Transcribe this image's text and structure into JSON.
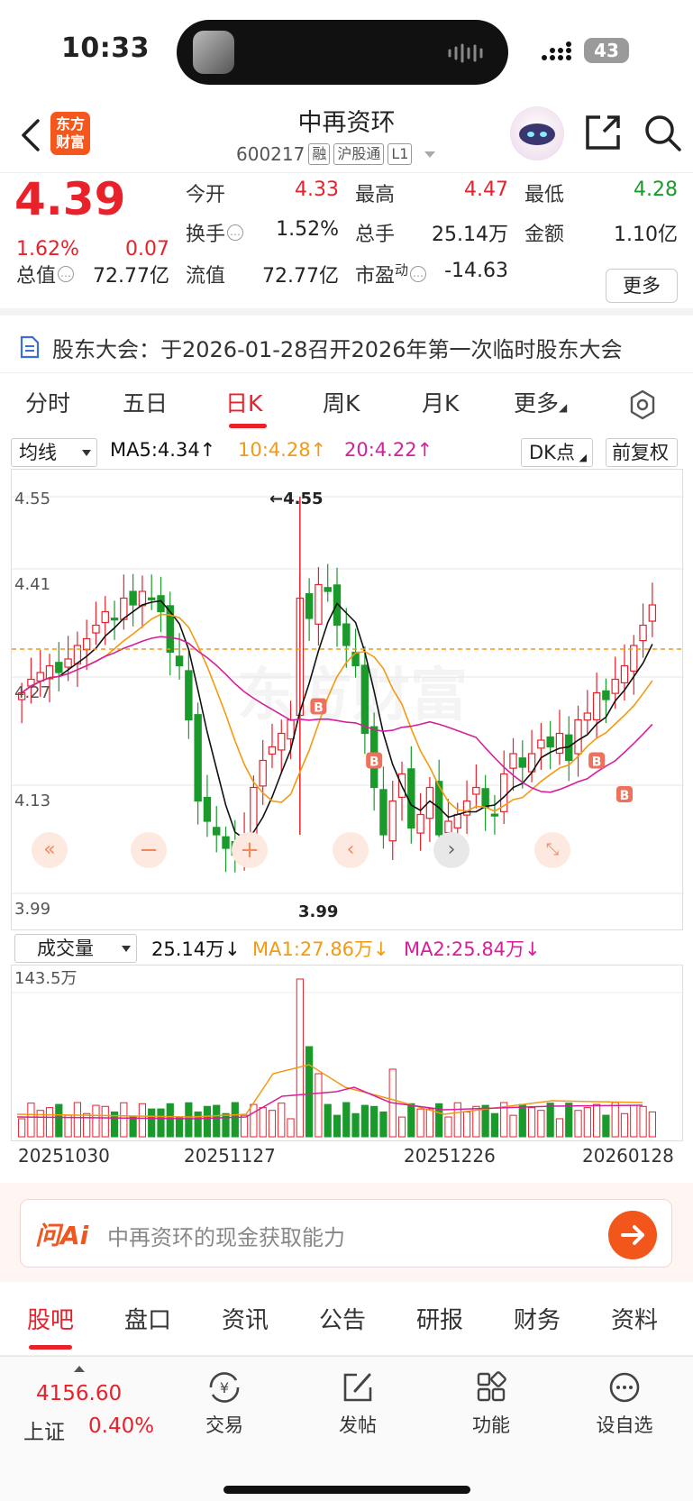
{
  "status": {
    "time": "10:33",
    "battery": "43"
  },
  "header": {
    "logo": "东方\n财富",
    "name": "中再资环",
    "code": "600217",
    "tags": [
      "融",
      "沪股通",
      "L1"
    ]
  },
  "quote": {
    "price": "4.39",
    "pct": "1.62%",
    "chg": "0.07",
    "rows": [
      {
        "l1": "今开",
        "v1": "4.33",
        "l2": "最高",
        "v2": "4.47",
        "l3": "最低",
        "v3": "4.28"
      },
      {
        "l1": "换手",
        "v1": "1.52%",
        "l2": "总手",
        "v2": "25.14万",
        "l3": "金额",
        "v3": "1.10亿"
      },
      {
        "l1": "总值",
        "v1": "72.77亿",
        "l2": "流值",
        "v2": "72.77亿",
        "l3": "市盈",
        "l3sup": "动",
        "v3": "-14.63"
      }
    ],
    "more": "更多",
    "colors": {
      "up": "#e8212b",
      "down": "#1a9a2a"
    }
  },
  "notice": "股东大会：于2026-01-28召开2026年第一次临时股东大会",
  "period_tabs": [
    "分时",
    "五日",
    "日K",
    "周K",
    "月K",
    "更多"
  ],
  "indicator": {
    "select": "均线",
    "ma5": "MA5:4.34↑",
    "ma10": "10:4.28↑",
    "ma20": "20:4.22↑",
    "dk": "DK点",
    "adjust": "前复权",
    "colors": {
      "ma5": "#111111",
      "ma10": "#f39a12",
      "ma20": "#d61f9a"
    }
  },
  "kline": {
    "y_ticks": [
      "4.55",
      "4.41",
      "4.27",
      "4.13",
      "3.99"
    ],
    "max_label": "←4.55",
    "min_label": "3.99",
    "watermark": "东方财富",
    "current_price": 4.39
  },
  "volume": {
    "select": "成交量",
    "value": "25.14万↓",
    "ma1": "MA1:27.86万↓",
    "ma2": "MA2:25.84万↓",
    "max_label": "143.5万",
    "dates": [
      "20251030",
      "20251127",
      "20251226",
      "20260128"
    ]
  },
  "ai": {
    "logo": "问Ai",
    "placeholder": "中再资环的现金获取能力"
  },
  "bottom_tabs": [
    "股吧",
    "盘口",
    "资讯",
    "公告",
    "研报",
    "财务",
    "资料"
  ],
  "nav": {
    "index_value": "4156.60",
    "index_name": "上证",
    "index_pct": "0.40%",
    "items": [
      "交易",
      "发帖",
      "功能",
      "设自选"
    ]
  }
}
